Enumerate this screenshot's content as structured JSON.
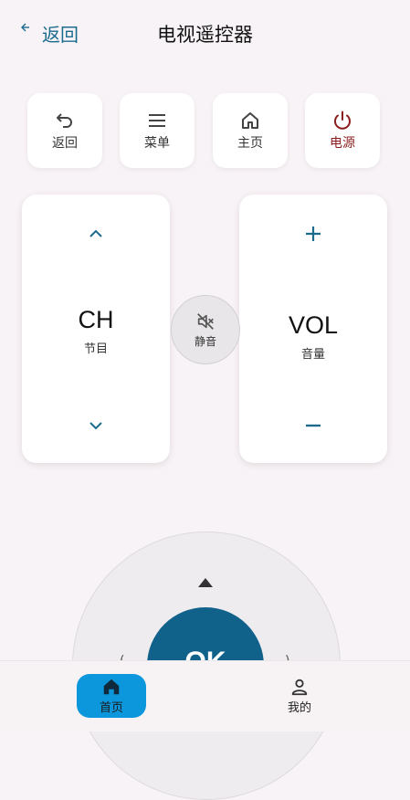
{
  "header": {
    "back_label": "返回",
    "title": "电视遥控器"
  },
  "tiles": [
    {
      "label": "返回",
      "icon": "undo-icon"
    },
    {
      "label": "菜单",
      "icon": "menu-icon"
    },
    {
      "label": "主页",
      "icon": "home-icon"
    },
    {
      "label": "电源",
      "icon": "power-icon"
    }
  ],
  "channel": {
    "title": "CH",
    "subtitle": "节目"
  },
  "volume": {
    "title": "VOL",
    "subtitle": "音量"
  },
  "mute": {
    "label": "静音"
  },
  "dpad": {
    "ok_label": "OK"
  },
  "bottom_nav": {
    "home_label": "首页",
    "me_label": "我的"
  },
  "colors": {
    "accent": "#11628a",
    "power": "#8b1d1d",
    "nav_active": "#0c97dc",
    "background": "#f8f3f6"
  }
}
